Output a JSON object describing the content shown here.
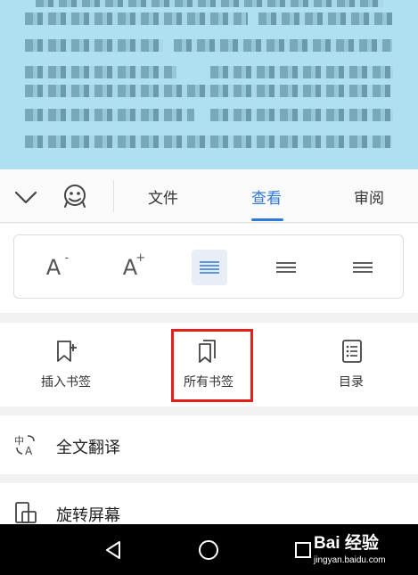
{
  "toolbar": {
    "tabs": [
      {
        "label": "文件"
      },
      {
        "label": "查看"
      },
      {
        "label": "审阅"
      }
    ],
    "active_tab": "查看",
    "accent_color": "#2f7ad8"
  },
  "format": {
    "decrease_font_icon": "font-size-decrease-icon",
    "increase_font_icon": "font-size-increase-icon",
    "align_options": [
      "align-justify-icon",
      "align-center-icon",
      "align-left-icon"
    ],
    "active_align": "align-justify-icon"
  },
  "bookmarks": {
    "items": [
      {
        "label": "插入书签",
        "icon": "bookmark-add-icon"
      },
      {
        "label": "所有书签",
        "icon": "bookmarks-icon"
      },
      {
        "label": "目录",
        "icon": "table-of-contents-icon"
      }
    ],
    "highlighted": "所有书签",
    "highlight_color": "#e5201c"
  },
  "menu": {
    "translate_label": "全文翻译",
    "rotate_label": "旋转屏幕"
  },
  "watermark": {
    "brand": "Bai 经验",
    "url": "jingyan.baidu.com"
  }
}
